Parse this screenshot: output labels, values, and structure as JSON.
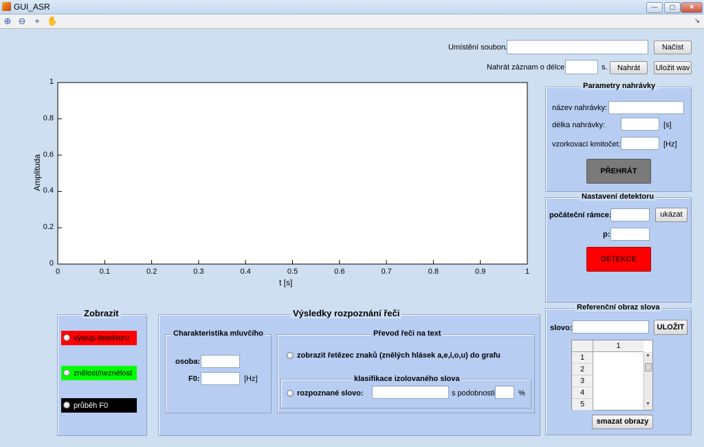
{
  "window": {
    "title": "GUI_ASR",
    "min": "—",
    "max": "▢",
    "close": "✕"
  },
  "toolbar": {
    "zoom_in": "⊕",
    "zoom_out": "⊖",
    "data_cursor": "⌖",
    "pan": "✋",
    "dock": "↘"
  },
  "file": {
    "location_label": "Umístění souboru:",
    "location_value": "",
    "load_button": "Načíst",
    "record_label": "Nahrát záznam o délce",
    "record_value": "",
    "record_unit": "s.",
    "record_button": "Nahrát",
    "save_wav_button": "Uložit wav"
  },
  "chart_data": {
    "type": "line",
    "title": "",
    "xlabel": "t [s]",
    "ylabel": "Amplituda",
    "xlim": [
      0,
      1
    ],
    "ylim": [
      0,
      1
    ],
    "xticks": [
      "0",
      "0.1",
      "0.2",
      "0.3",
      "0.4",
      "0.5",
      "0.6",
      "0.7",
      "0.8",
      "0.9",
      "1"
    ],
    "yticks": [
      "0",
      "0.2",
      "0.4",
      "0.6",
      "0.8",
      "1"
    ],
    "series": []
  },
  "params": {
    "title": "Parametry nahrávky",
    "name_label": "název nahrávky:",
    "name_value": "",
    "length_label": "délka nahrávky:",
    "length_value": "",
    "length_unit": "[s]",
    "fs_label": "vzorkovací kmitočet:",
    "fs_value": "",
    "fs_unit": "[Hz]",
    "play_button": "PŘEHRÁT"
  },
  "detector": {
    "title": "Nastavení detektoru",
    "frames_label": "počáteční rámce:",
    "frames_value": "",
    "show_button": "ukázat",
    "p_label": "p:",
    "p_value": "",
    "detect_button": "DETEKCE"
  },
  "reference": {
    "title": "Referenční obraz slova",
    "word_label": "slovo:",
    "word_value": "",
    "save_button": "ULOŽIT",
    "table_header": "1",
    "row_numbers": [
      "1",
      "2",
      "3",
      "4",
      "5"
    ],
    "delete_button": "smazat obrazy"
  },
  "display": {
    "title": "Zobrazit",
    "options": [
      {
        "label": "výstup detektoru",
        "color": "#ff0000"
      },
      {
        "label": "znělost/neznělost",
        "color": "#00ff00"
      },
      {
        "label": "průběh F0",
        "color": "#000000"
      }
    ]
  },
  "results": {
    "title": "Výsledky rozpoznání řeči",
    "speaker": {
      "title": "Charakteristika mluvčího",
      "person_label": "osoba:",
      "person_value": "",
      "f0_label": "F0:",
      "f0_value": "",
      "f0_unit": "[Hz]"
    },
    "conversion": {
      "title": "Převod řeči na text",
      "show_string_label": "zobrazit řetězec znaků  (znělých hlásek a,e,i,o,u) do grafu",
      "classification_title": "klasifikace izolovaného slova",
      "recognized_label": "rozpoznané slovo:",
      "recognized_value": "",
      "similarity_label": "s podobností",
      "similarity_value": "",
      "percent": "%"
    }
  }
}
